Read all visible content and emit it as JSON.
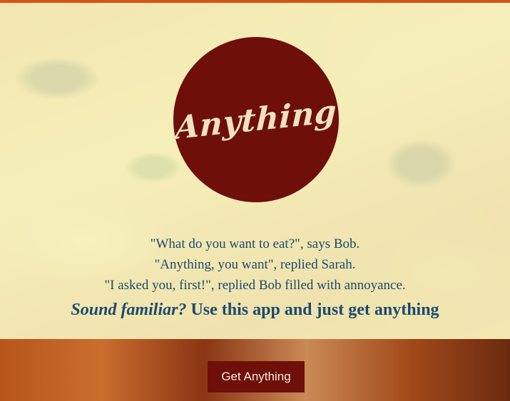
{
  "logo": {
    "text": "Anything"
  },
  "quotes": [
    "\"What do you want to eat?\", says Bob.",
    "\"Anything, you want\", replied Sarah.",
    "\"I asked you, first!\", replied Bob filled with annoyance."
  ],
  "tagline": {
    "emphasis": "Sound familiar?",
    "rest": " Use this app and just get anything"
  },
  "cta": {
    "label": "Get Anything"
  },
  "colors": {
    "accent_bar": "#d4531a",
    "brand": "#6e0f0a",
    "text": "#1c4a6e",
    "overlay": "#f8f5c4"
  }
}
